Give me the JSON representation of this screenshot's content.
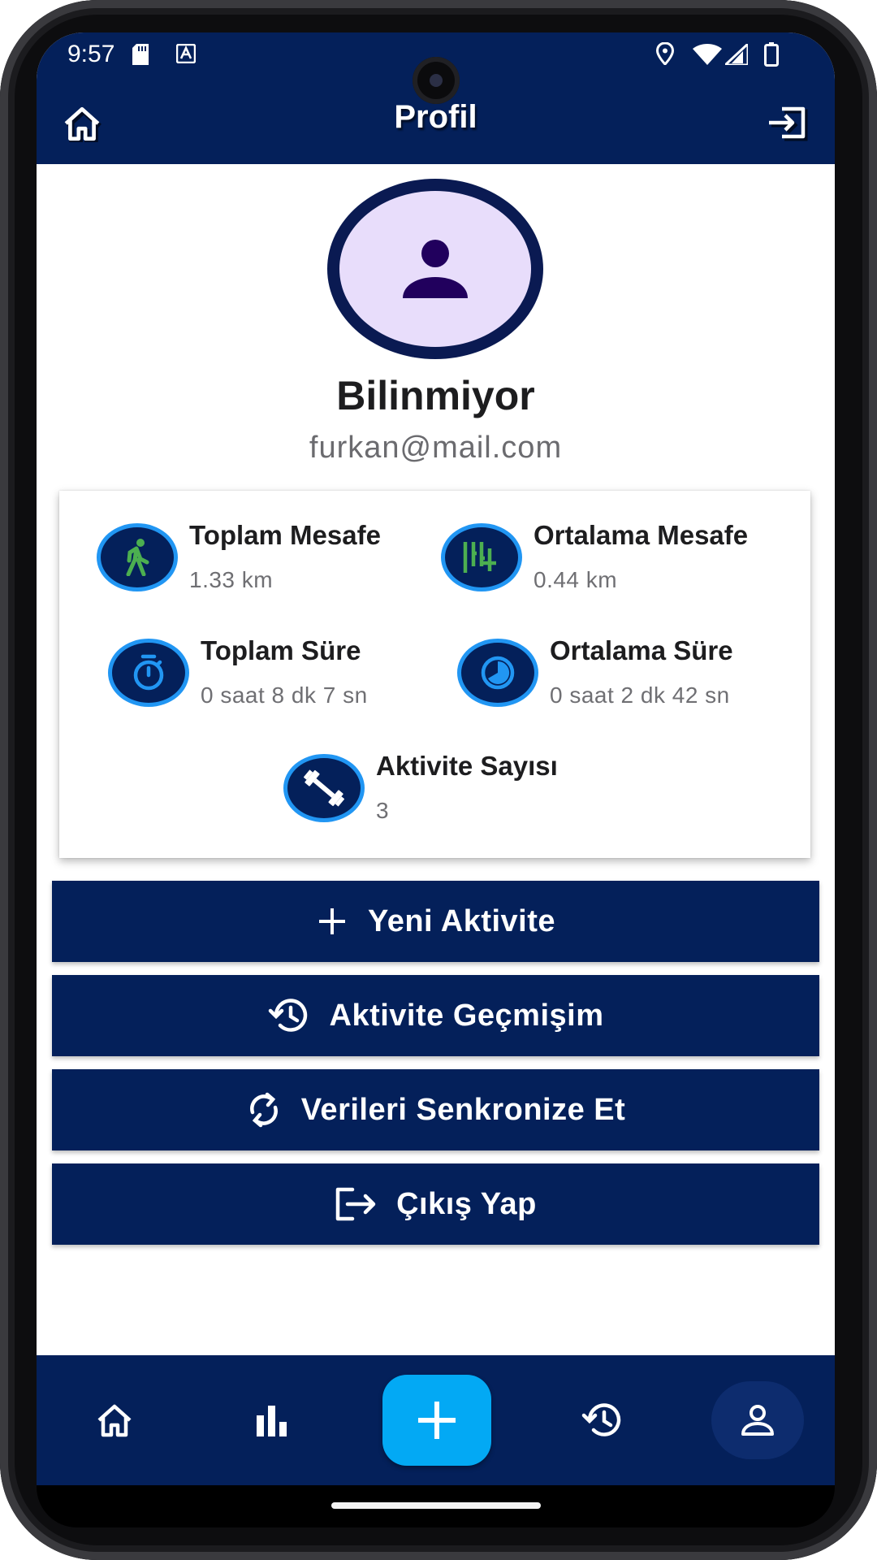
{
  "status_bar": {
    "time": "9:57",
    "icons": [
      "sd-card-icon",
      "keyboard-a-icon",
      "location-icon",
      "wifi-icon",
      "signal-icon",
      "battery-icon"
    ]
  },
  "header": {
    "title": "Profil",
    "left_icon": "home-icon",
    "right_icon": "logout-icon"
  },
  "profile": {
    "name": "Bilinmiyor",
    "email": "furkan@mail.com",
    "avatar_icon": "person-icon"
  },
  "stats": [
    {
      "title": "Toplam Mesafe",
      "value": "1.33 km",
      "icon": "walking-icon"
    },
    {
      "title": "Ortalama Mesafe",
      "value": "0.44 km",
      "icon": "distance-average-icon"
    },
    {
      "title": "Toplam Süre",
      "value": "0 saat 8 dk 7 sn",
      "icon": "stopwatch-icon"
    },
    {
      "title": "Ortalama Süre",
      "value": "0 saat 2 dk 42 sn",
      "icon": "clock-pie-icon"
    },
    {
      "title": "Aktivite Sayısı",
      "value": "3",
      "icon": "dumbbell-icon"
    }
  ],
  "actions": {
    "new_activity": "Yeni Aktivite",
    "history": "Aktivite Geçmişim",
    "sync": "Verileri Senkronize Et",
    "logout": "Çıkış Yap"
  },
  "bottom_nav": {
    "items": [
      "home-icon",
      "bar-chart-icon",
      "add-icon",
      "history-icon",
      "person-icon"
    ],
    "active_index": 4
  },
  "colors": {
    "primary": "#04205a",
    "accent": "#2196f3",
    "fab": "#03a9f4",
    "stat_icon_green": "#4caf50",
    "avatar_bg": "#e8ddfb"
  }
}
